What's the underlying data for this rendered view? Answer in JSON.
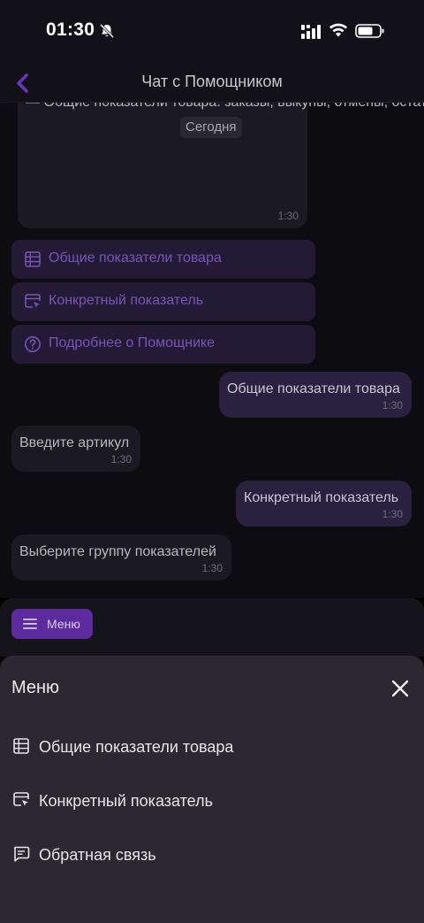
{
  "status_bar": {
    "time": "01:30",
    "icons": [
      "bell-slash-icon",
      "signal-icon",
      "wifi-icon",
      "battery-icon"
    ]
  },
  "header": {
    "title": "Чат с Помощником",
    "back_icon": "chevron-left-icon"
  },
  "chat": {
    "date_label": "Сегодня",
    "long_message": {
      "text": "— Общие показатели товара: заказы, выкупы, отмены, остатки на складах и прочее\n\n— Конкретный показатель из группы: продажи, цены и скидки, остатки и поставки, видимость и спрос",
      "time": "1:30"
    },
    "quick_buttons": [
      {
        "label": "Общие показатели товара",
        "icon": "table-icon"
      },
      {
        "label": "Конкретный показатель",
        "icon": "cursor-select-icon"
      },
      {
        "label": "Подробнее о Помощнике",
        "icon": "help-circle-icon"
      }
    ],
    "messages": [
      {
        "side": "out",
        "text": "Общие показатели товара",
        "time": "1:30"
      },
      {
        "side": "in",
        "text": "Введите артикул",
        "time": "1:30"
      },
      {
        "side": "out",
        "text": "Конкретный показатель",
        "time": "1:30"
      },
      {
        "side": "in",
        "text": "Выберите группу показателей",
        "time": "1:30"
      }
    ]
  },
  "menu_bar": {
    "button_label": "Меню",
    "icon": "hamburger-icon"
  },
  "sheet": {
    "title": "Меню",
    "close_icon": "close-icon",
    "items": [
      {
        "label": "Общие показатели товара",
        "icon": "table-icon"
      },
      {
        "label": "Конкретный показатель",
        "icon": "cursor-select-icon"
      },
      {
        "label": "Обратная связь",
        "icon": "chat-feedback-icon"
      }
    ]
  },
  "colors": {
    "accent": "#5e2b9e",
    "accent_text": "#7a53b8",
    "outgoing_bubble": "#2a2140",
    "incoming_bubble": "#1c1a21",
    "sheet_bg": "#2b2832"
  }
}
